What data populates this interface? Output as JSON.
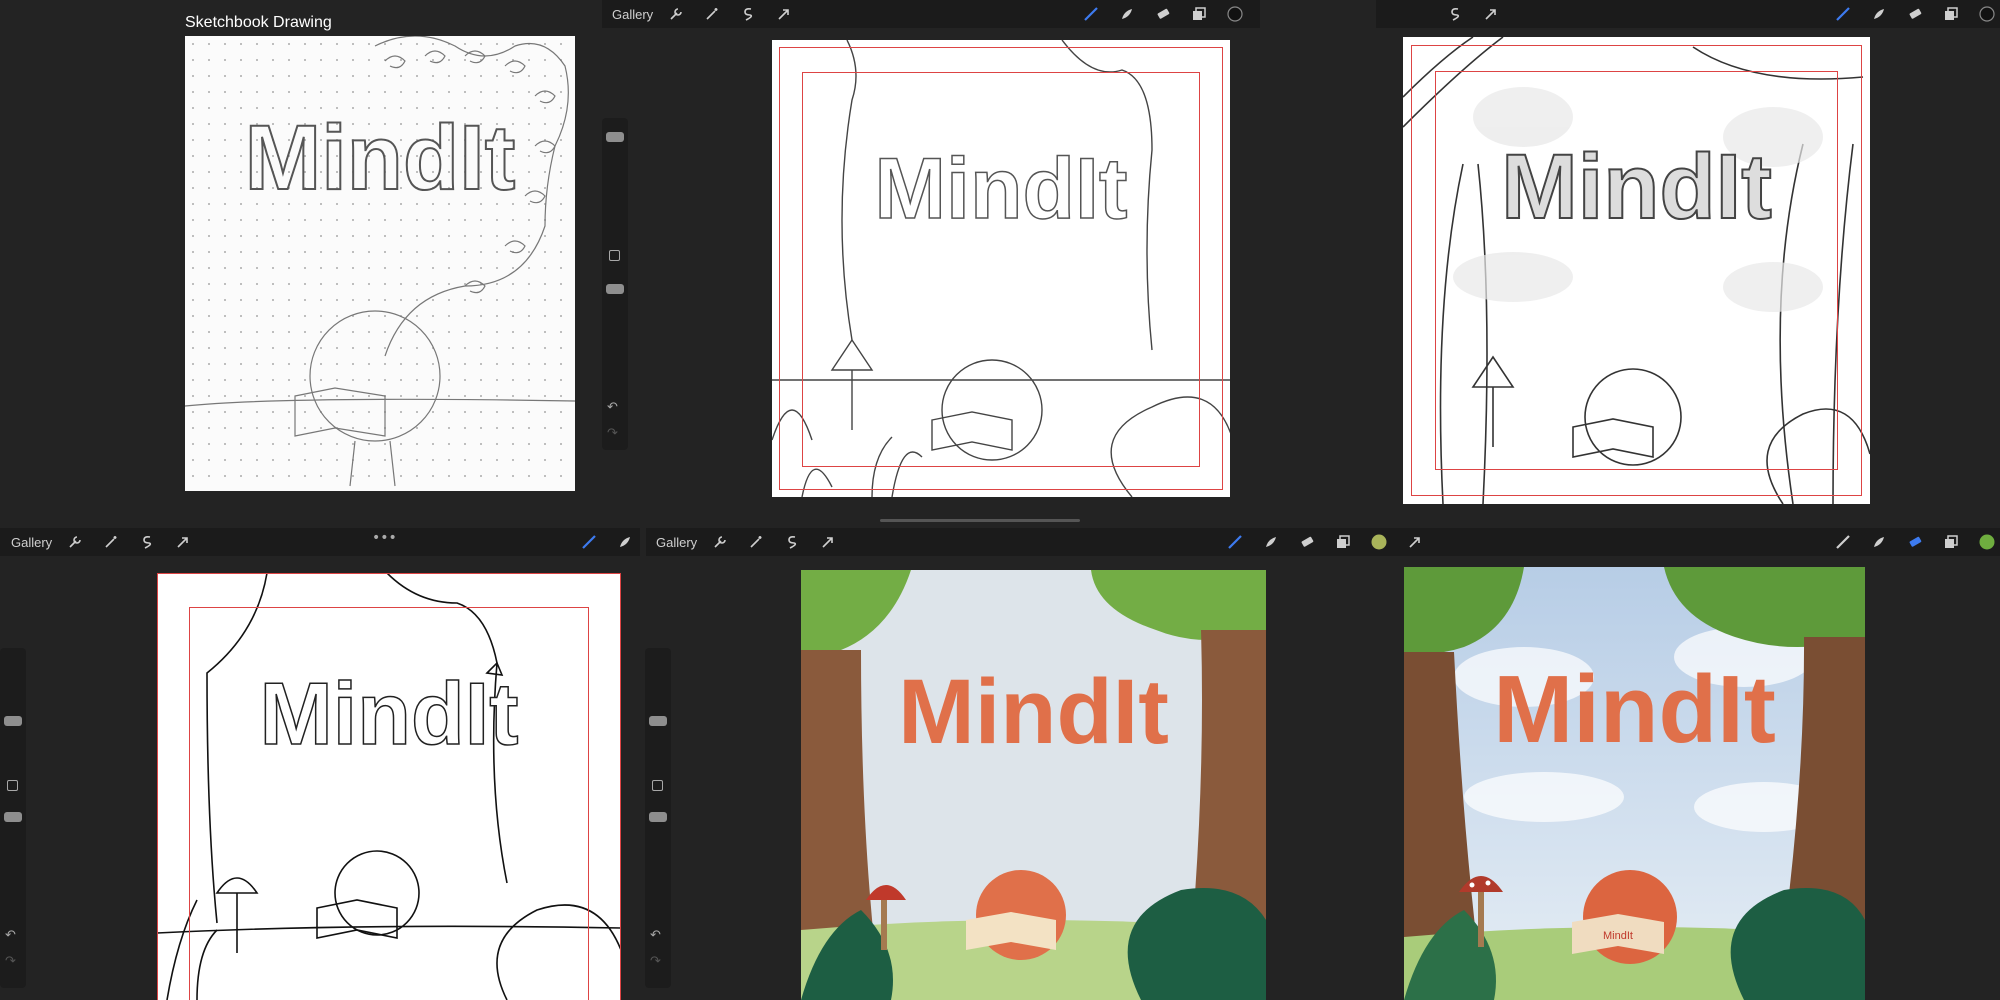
{
  "title": "Sketchbook Drawing",
  "toolbar": {
    "gallery_label": "Gallery",
    "left_icons": [
      "wrench-icon",
      "magic-wand-icon",
      "selection-icon",
      "transform-arrow-icon"
    ],
    "right_icons": [
      "brush-icon",
      "smudge-icon",
      "eraser-icon",
      "layers-icon",
      "color-swatch-icon"
    ]
  },
  "artwork": {
    "logo": "MindIt",
    "book_label": "MindIt"
  },
  "colors": {
    "accent_blue": "#3d7bf0",
    "logo_orange": "#e0704a",
    "logo_yellow": "#e8a04a",
    "swatch_olive": "#a9b45a",
    "swatch_green": "#6fae3f",
    "sky": "#dde4ea",
    "trunk": "#8a5a3c",
    "tree_green": "#73ad45",
    "grass": "#b8d48a",
    "dark_green": "#1d5e43"
  }
}
